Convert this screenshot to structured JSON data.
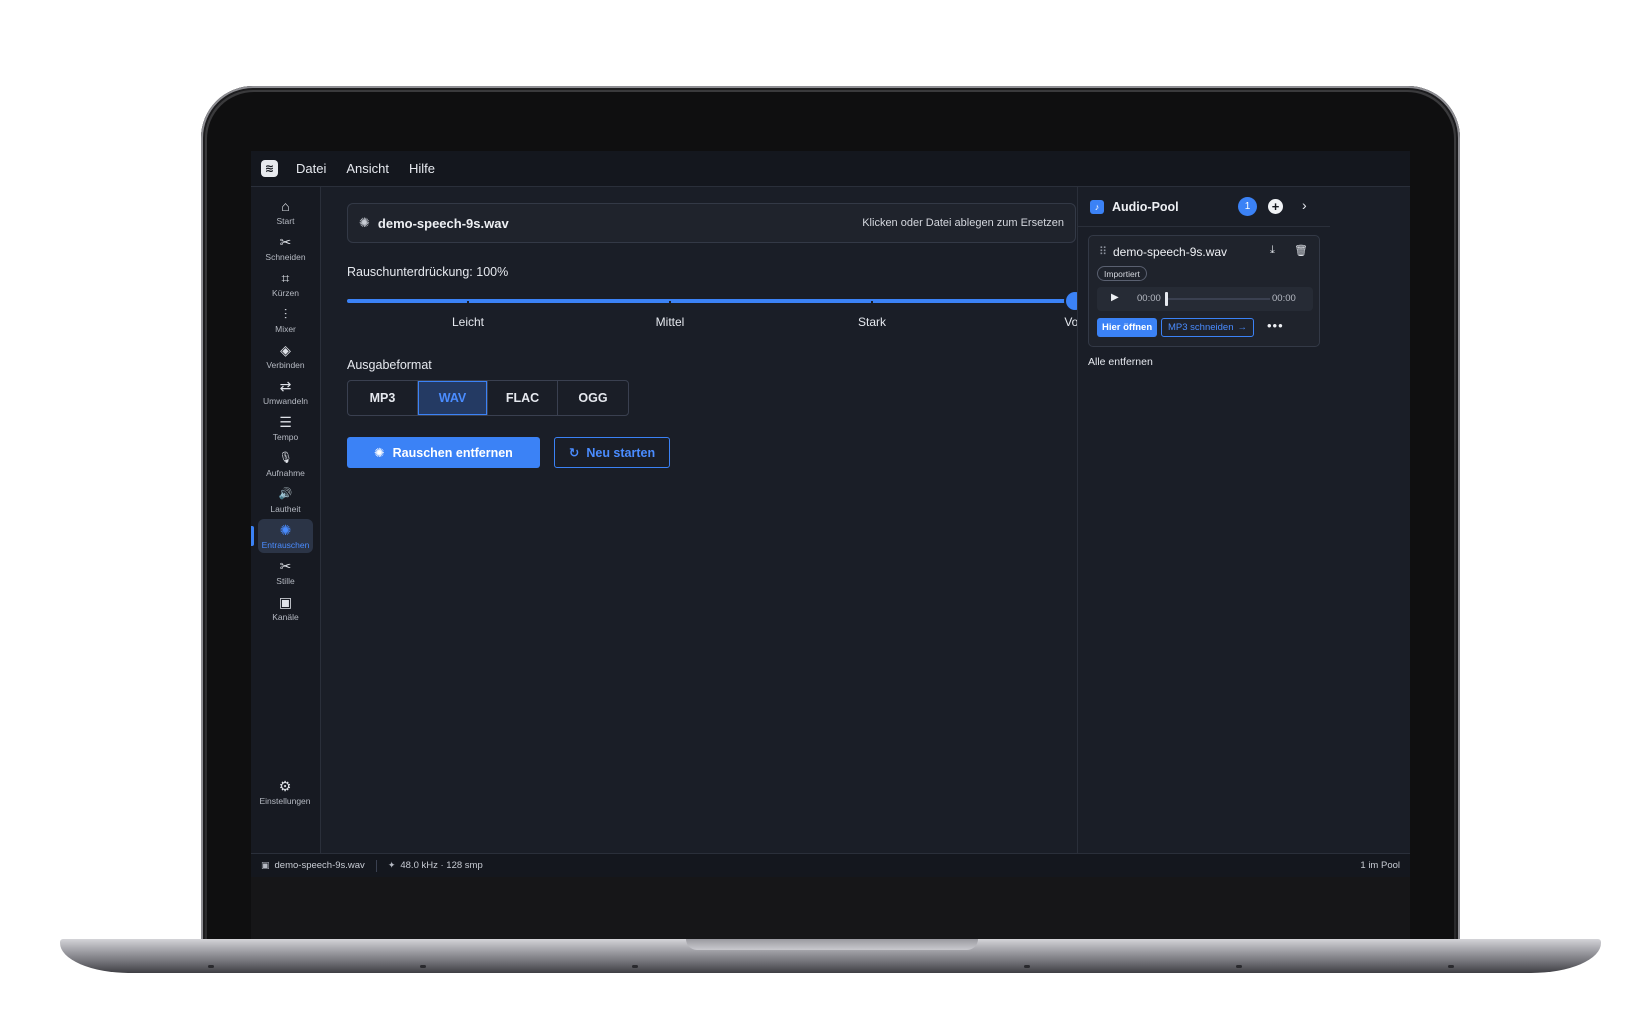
{
  "menubar": {
    "logo": "≋",
    "items": [
      "Datei",
      "Ansicht",
      "Hilfe"
    ]
  },
  "sidebar": {
    "items": [
      {
        "label": "Start",
        "icon": "home-icon",
        "glyph": "⌂"
      },
      {
        "label": "Schneiden",
        "icon": "scissors-icon",
        "glyph": "✂"
      },
      {
        "label": "Kürzen",
        "icon": "crop-icon",
        "glyph": "⌗"
      },
      {
        "label": "Mixer",
        "icon": "mixer-icon",
        "glyph": "⫶"
      },
      {
        "label": "Verbinden",
        "icon": "layers-icon",
        "glyph": "◈"
      },
      {
        "label": "Umwandeln",
        "icon": "convert-icon",
        "glyph": "⇄"
      },
      {
        "label": "Tempo",
        "icon": "sliders-icon",
        "glyph": "☰"
      },
      {
        "label": "Aufnahme",
        "icon": "microphone-icon",
        "glyph": "🎙"
      },
      {
        "label": "Lautheit",
        "icon": "speaker-icon",
        "glyph": "🔊"
      },
      {
        "label": "Entrauschen",
        "icon": "denoise-icon",
        "glyph": "✺"
      },
      {
        "label": "Stille",
        "icon": "scissors-icon",
        "glyph": "✂"
      },
      {
        "label": "Kanäle",
        "icon": "speaker-box-icon",
        "glyph": "▣"
      }
    ],
    "active_index": 9,
    "settings": {
      "label": "Einstellungen",
      "icon": "gear-icon",
      "glyph": "⚙"
    }
  },
  "main": {
    "file": {
      "name": "demo-speech-9s.wav",
      "hint": "Klicken oder Datei ablegen zum Ersetzen",
      "icon": "denoise-icon"
    },
    "slider": {
      "label": "Rauschunterdrückung: 100%",
      "value_percent": 100,
      "ticks": [
        "Leicht",
        "Mittel",
        "Stark",
        "Voll"
      ]
    },
    "format": {
      "label": "Ausgabeformat",
      "options": [
        "MP3",
        "WAV",
        "FLAC",
        "OGG"
      ],
      "selected": "WAV"
    },
    "actions": {
      "primary": "Rauschen entfernen",
      "secondary": "Neu starten"
    }
  },
  "pool": {
    "title": "Audio-Pool",
    "count_badge": "1",
    "item": {
      "name": "demo-speech-9s.wav",
      "tag": "Importiert",
      "time_current": "00:00",
      "time_total": "00:00",
      "progress_fraction": 0,
      "open_label": "Hier öffnen",
      "mp3_label": "MP3 schneiden"
    },
    "remove_all": "Alle entfernen"
  },
  "statusbar": {
    "file": "demo-speech-9s.wav",
    "info": "48.0 kHz · 128 smp",
    "pool": "1 im Pool"
  },
  "colors": {
    "accent": "#3b82f6",
    "background": "#1a1e27",
    "panel": "#1f232c"
  }
}
